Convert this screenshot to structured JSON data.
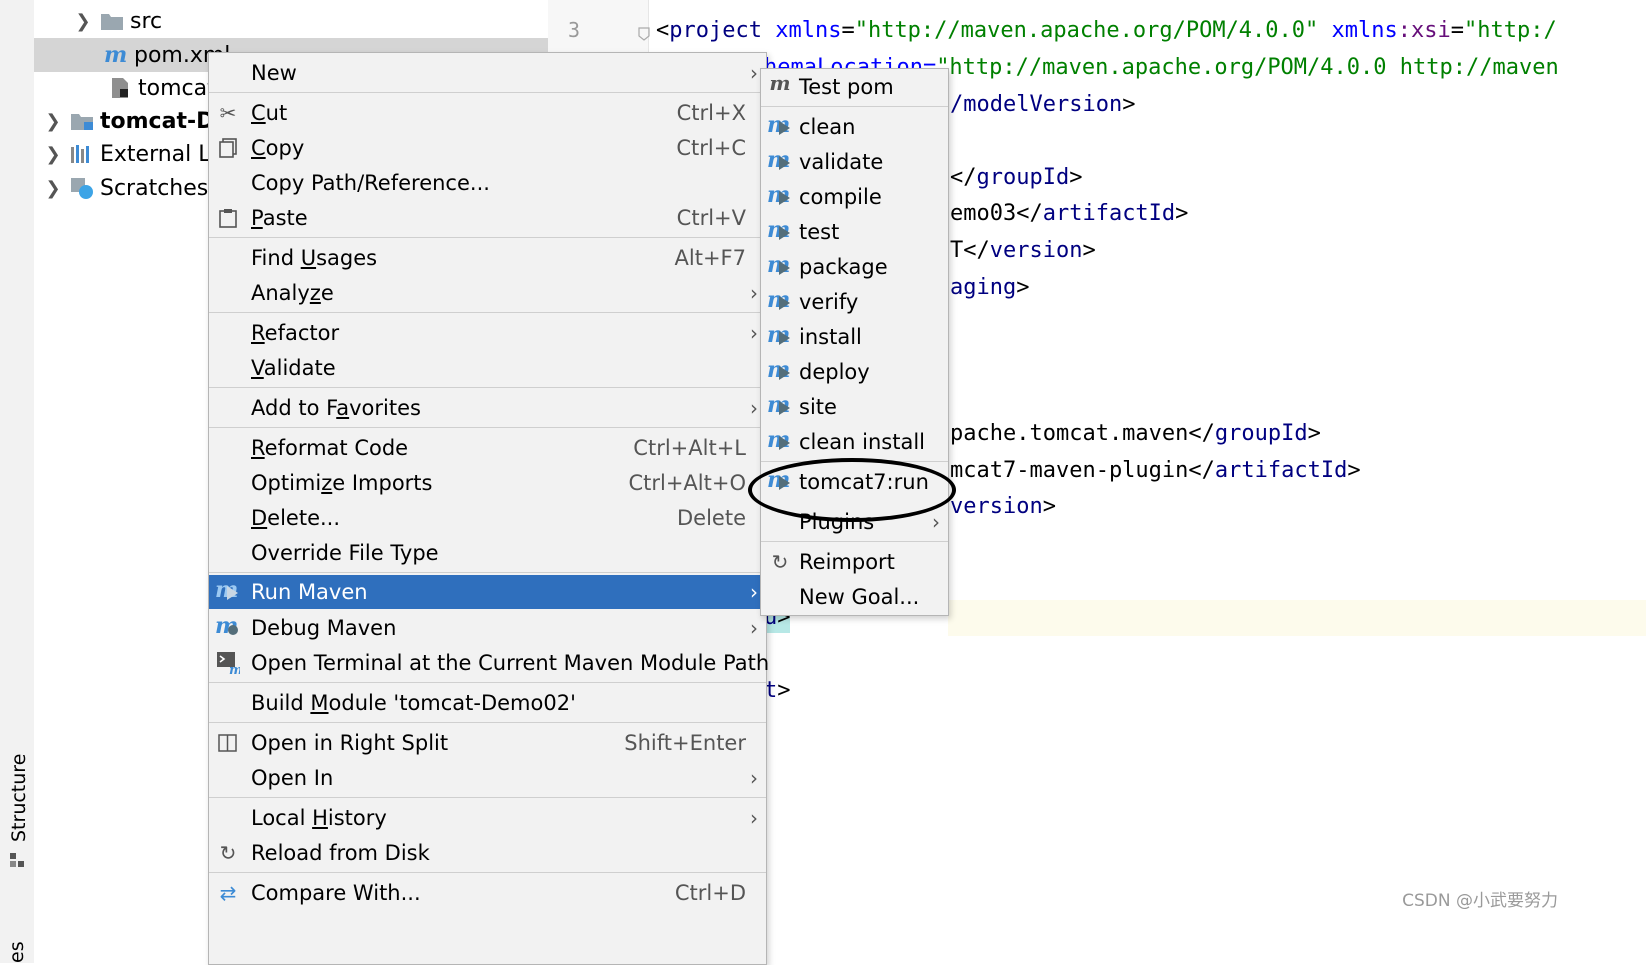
{
  "tool_window": {
    "structure_tab": "Structure",
    "bottom_fragment": "es"
  },
  "project_tree": {
    "rows": [
      {
        "label": "src",
        "expandable": true
      },
      {
        "label": "pom.xml",
        "selected": true
      },
      {
        "label": "tomcat-"
      },
      {
        "label": "tomcat-De",
        "expandable": true,
        "bold": true
      },
      {
        "label": "External Li",
        "expandable": true
      },
      {
        "label": "Scratches a",
        "expandable": true
      }
    ]
  },
  "editor": {
    "line_number": "3",
    "lines": [
      {
        "prefix": "",
        "tag": "project",
        "a1": "xmlns",
        "v1": "\"http://maven.apache.org/POM/4.0.0\"",
        "a2ns": "xmlns",
        "a2": ":xsi",
        "v2": "\"http:/"
      },
      {
        "text_a": "hemaLocation=",
        "text_b": "\"http://maven.apache.org/POM/4.0.0 http://maven"
      },
      {
        "pre": "/",
        "tag": "modelVersion",
        "post": ">"
      },
      {
        "pre": "</",
        "tag": "groupId",
        "post": ">"
      },
      {
        "pre": "emo03</",
        "tag": "artifactId",
        "post": ">"
      },
      {
        "pre": "T</",
        "tag": "version",
        "post": ">"
      },
      {
        "pre": "",
        "tag": "aging",
        "post": ">"
      },
      {
        "pre": "pache.tomcat.maven</",
        "tag": "groupId",
        "post": ">"
      },
      {
        "pre": "mcat7-maven-plugin</",
        "tag": "artifactId",
        "post": ">"
      },
      {
        "pre": "",
        "tag": "version",
        "post": ">"
      },
      {
        "pre": "",
        "tag": "u",
        "post": ">"
      },
      {
        "pre": "",
        "tag": "t",
        "post": ">"
      }
    ]
  },
  "context_menu": {
    "items": [
      {
        "label": "New",
        "submenu": true
      },
      {
        "label": "Cut",
        "mnemonic_pre": "",
        "mnemonic": "C",
        "mnemonic_post": "ut",
        "shortcut": "Ctrl+X",
        "icon": "scissors-icon"
      },
      {
        "label": "Copy",
        "mnemonic_pre": "",
        "mnemonic": "C",
        "mnemonic_post": "opy",
        "shortcut": "Ctrl+C",
        "icon": "copy-icon"
      },
      {
        "label": "Copy Path/Reference..."
      },
      {
        "label": "Paste",
        "mnemonic_pre": "",
        "mnemonic": "P",
        "mnemonic_post": "aste",
        "shortcut": "Ctrl+V",
        "icon": "clipboard-icon"
      },
      {
        "label": "Find Usages",
        "mnemonic_pre": "Find ",
        "mnemonic": "U",
        "mnemonic_post": "sages",
        "shortcut": "Alt+F7"
      },
      {
        "label": "Analyze",
        "mnemonic_pre": "Analy",
        "mnemonic": "z",
        "mnemonic_post": "e",
        "submenu": true
      },
      {
        "label": "Refactor",
        "mnemonic_pre": "",
        "mnemonic": "R",
        "mnemonic_post": "efactor",
        "submenu": true
      },
      {
        "label": "Validate",
        "mnemonic_pre": "",
        "mnemonic": "V",
        "mnemonic_post": "alidate"
      },
      {
        "label": "Add to Favorites",
        "mnemonic_pre": "Add to F",
        "mnemonic": "a",
        "mnemonic_post": "vorites",
        "submenu": true
      },
      {
        "label": "Reformat Code",
        "mnemonic_pre": "",
        "mnemonic": "R",
        "mnemonic_post": "eformat Code",
        "shortcut": "Ctrl+Alt+L"
      },
      {
        "label": "Optimize Imports",
        "mnemonic_pre": "Optimi",
        "mnemonic": "z",
        "mnemonic_post": "e Imports",
        "shortcut": "Ctrl+Alt+O"
      },
      {
        "label": "Delete...",
        "mnemonic_pre": "",
        "mnemonic": "D",
        "mnemonic_post": "elete...",
        "shortcut": "Delete"
      },
      {
        "label": "Override File Type"
      },
      {
        "label": "Run Maven",
        "submenu": true,
        "active": true,
        "icon": "maven-run-icon"
      },
      {
        "label": "Debug Maven",
        "submenu": true,
        "icon": "maven-debug-icon"
      },
      {
        "label": "Open Terminal at the Current Maven Module Path",
        "icon": "terminal-maven-icon"
      },
      {
        "label": "Build Module 'tomcat-Demo02'",
        "mnemonic_pre": "Build ",
        "mnemonic": "M",
        "mnemonic_post": "odule 'tomcat-Demo02'"
      },
      {
        "label": "Open in Right Split",
        "shortcut": "Shift+Enter",
        "icon": "split-icon"
      },
      {
        "label": "Open In",
        "submenu": true
      },
      {
        "label": "Local History",
        "mnemonic_pre": "Local ",
        "mnemonic": "H",
        "mnemonic_post": "istory",
        "submenu": true
      },
      {
        "label": "Reload from Disk",
        "icon": "reload-icon"
      },
      {
        "label": "Compare With...",
        "shortcut": "Ctrl+D",
        "icon": "compare-icon"
      }
    ]
  },
  "run_maven_submenu": {
    "items": [
      {
        "label": "Test pom",
        "icon": "maven-icon"
      },
      {
        "label": "clean"
      },
      {
        "label": "validate"
      },
      {
        "label": "compile"
      },
      {
        "label": "test"
      },
      {
        "label": "package"
      },
      {
        "label": "verify"
      },
      {
        "label": "install"
      },
      {
        "label": "deploy"
      },
      {
        "label": "site"
      },
      {
        "label": "clean install"
      },
      {
        "label": "tomcat7:run",
        "circled": true
      },
      {
        "label": "Plugins",
        "submenu": true
      },
      {
        "label": "Reimport",
        "icon": "reload-icon"
      },
      {
        "label": "New Goal..."
      }
    ]
  },
  "watermark": "CSDN @小武要努力",
  "colors": {
    "menu_bg": "#f2f2f2",
    "selection": "#2f6fbd",
    "maven_blue": "#3d8bd5",
    "xml_tag": "#000080",
    "xml_string": "#008000"
  }
}
